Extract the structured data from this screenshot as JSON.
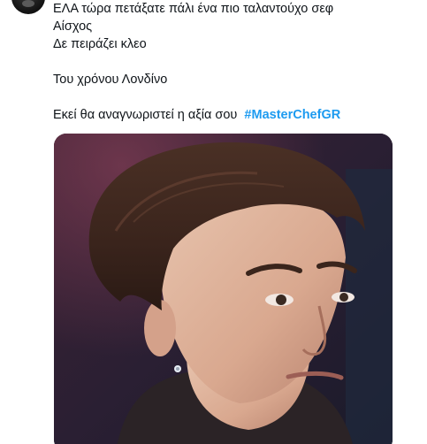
{
  "tweet": {
    "lines": [
      "ΕΛΑ τώρα πετάξατε πάλι ένα πιο ταλαντούχο σεφ",
      "Αίσχος",
      "Δε πειράζει κλεο",
      "",
      "Του χρόνου Λονδίνο",
      "",
      "Εκεί θα αναγνωριστεί η αξία σου"
    ],
    "hashtag": "#MasterChefGR"
  },
  "media": {
    "image_icon": "photo-of-young-man-with-earring"
  },
  "colors": {
    "text": "#0f1419",
    "hashtag": "#1d9bf0",
    "background": "#ffffff"
  }
}
